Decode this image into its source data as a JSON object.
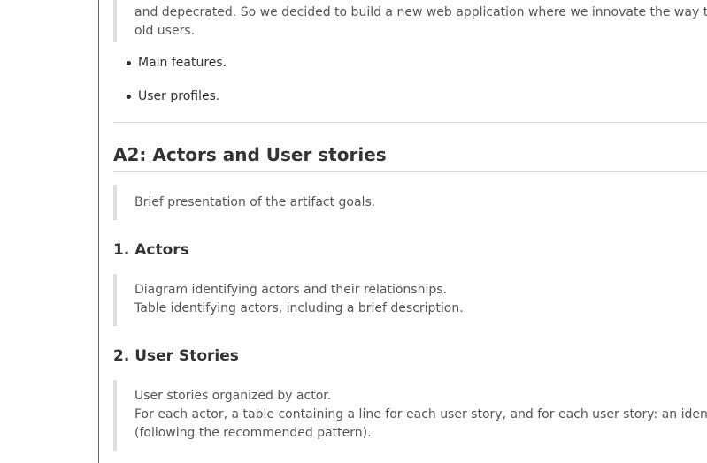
{
  "intro_quote": {
    "lines": [
      "and depecrated. So we decided to build a new web application where we innovate the way the Q&",
      "old users."
    ]
  },
  "features": [
    "Main features.",
    "User profiles."
  ],
  "section_a2": {
    "title": "A2: Actors and User stories",
    "summary": "Brief presentation of the artifact goals."
  },
  "actors": {
    "heading": "1. Actors",
    "lines": [
      "Diagram identifying actors and their relationships.",
      "Table identifying actors, including a brief description."
    ]
  },
  "user_stories": {
    "heading": "2. User Stories",
    "lines": [
      "User stories organized by actor.",
      "For each actor, a table containing a line for each user story, and for each user story: an identifier, a",
      "(following the recommended pattern)."
    ]
  }
}
